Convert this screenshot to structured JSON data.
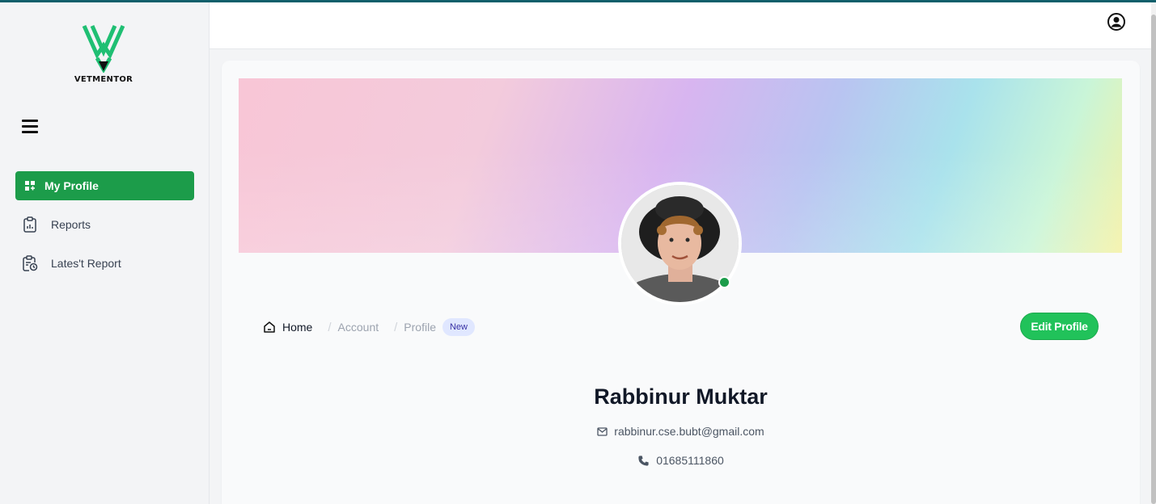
{
  "brand": {
    "name": "VETMENTOR",
    "accent": "#1c9c4a",
    "logo_color": "#1fbf73"
  },
  "sidebar": {
    "menu_icon": "hamburger-icon",
    "items": [
      {
        "label": "My Profile",
        "icon": "dashboard-icon",
        "active": true
      },
      {
        "label": "Reports",
        "icon": "clipboard-chart-icon",
        "active": false
      },
      {
        "label": "Lates't Report",
        "icon": "clipboard-clock-icon",
        "active": false
      }
    ]
  },
  "header": {
    "user_icon": "user-circle-icon"
  },
  "profile": {
    "breadcrumb": {
      "home": "Home",
      "account": "Account",
      "profile": "Profile",
      "badge": "New"
    },
    "edit_label": "Edit Profile",
    "name": "Rabbinur Muktar",
    "email": "rabbinur.cse.bubt@gmail.com",
    "phone": "01685111860",
    "status": "online"
  }
}
